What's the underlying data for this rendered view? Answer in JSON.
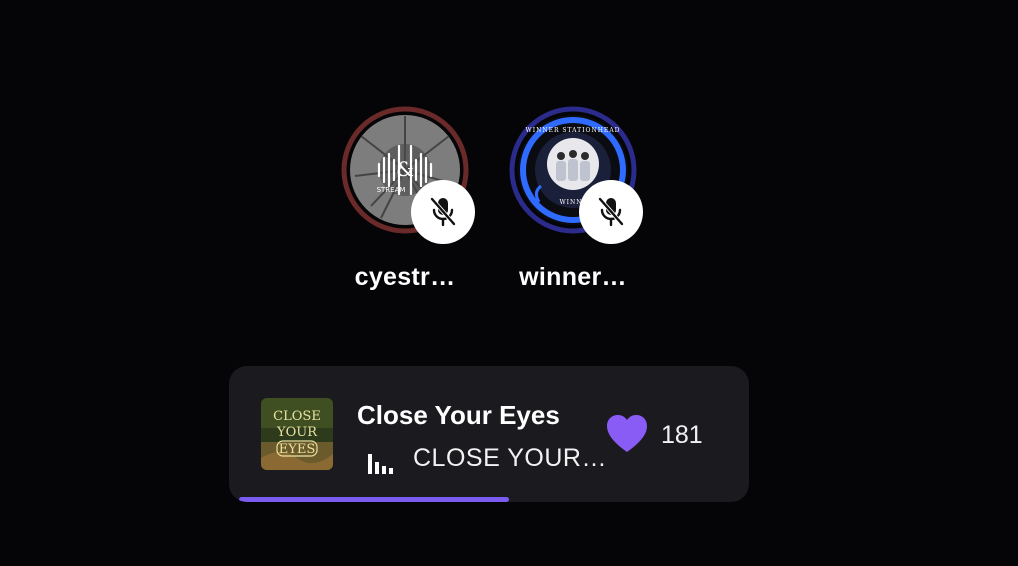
{
  "hosts": [
    {
      "name": "cyestr…",
      "muted": true,
      "ring_color": "#5a2323",
      "avatar_icon": "audio-wave-logo-icon"
    },
    {
      "name": "winner…",
      "muted": true,
      "ring_color": "#2b2f8f",
      "avatar_icon": "group-photo-badge-icon"
    }
  ],
  "player": {
    "title": "Close Your Eyes",
    "subtitle": "CLOSE YOUR…",
    "likes": "181",
    "progress": 0.52,
    "accent_color": "#7b5cf0",
    "album_art_icon": "close-your-eyes-album-art"
  }
}
